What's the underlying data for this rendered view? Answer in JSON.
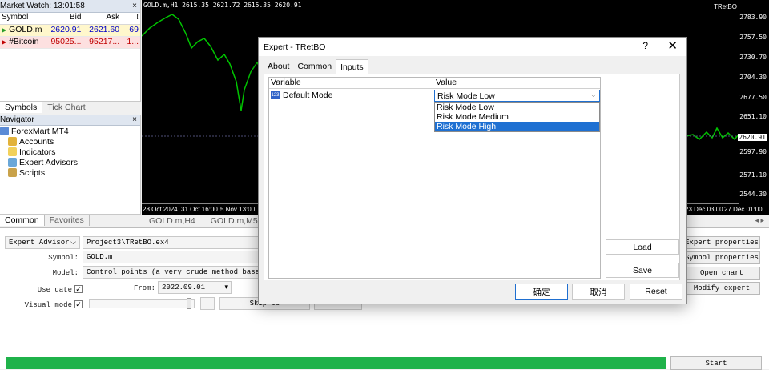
{
  "market_watch": {
    "title": "Market Watch: 13:01:58",
    "close": "×",
    "headers": {
      "symbol": "Symbol",
      "bid": "Bid",
      "ask": "Ask",
      "spread": "!"
    },
    "rows": [
      {
        "symbol": "GOLD.m",
        "bid": "2620.91",
        "ask": "2621.60",
        "spread": "69"
      },
      {
        "symbol": "#Bitcoin",
        "bid": "95025...",
        "ask": "95217...",
        "spread": "1..."
      }
    ],
    "tabs": [
      "Symbols",
      "Tick Chart"
    ]
  },
  "navigator": {
    "title": "Navigator",
    "close": "×",
    "root": "ForexMart MT4",
    "items": [
      "Accounts",
      "Indicators",
      "Expert Advisors",
      "Scripts"
    ],
    "tabs": [
      "Common",
      "Favorites"
    ]
  },
  "chart": {
    "header": "GOLD.m,H1  2615.35 2621.72 2615.35 2620.91",
    "name": "TRetBO",
    "prices": [
      "2783.90",
      "2757.50",
      "2730.70",
      "2704.30",
      "2677.50",
      "2651.10",
      "2620.91",
      "2597.90",
      "2571.10",
      "2544.30"
    ],
    "current_price": "2620.91",
    "times_left": [
      "28 Oct 2024",
      "31 Oct 16:00",
      "5 Nov 13:00"
    ],
    "times_right": [
      "23 Dec 03:00",
      "27 Dec 01:00"
    ],
    "tabs": [
      "GOLD.m,H4",
      "GOLD.m,M5"
    ],
    "colors": {
      "background": "#000000",
      "candles": "#00c400"
    }
  },
  "tester": {
    "type": "Expert Advisor",
    "ea_path": "Project3\\TRetBO.ex4",
    "symbol_label": "Symbol:",
    "symbol": "GOLD.m",
    "model_label": "Model:",
    "model": "Control points (a very crude method based on the",
    "use_date_label": "Use date",
    "from_label": "From:",
    "from_date": "2022.09.01",
    "visual_mode_label": "Visual mode",
    "skip_label": "Skip to",
    "buttons": {
      "expert_properties": "Expert properties",
      "symbol_properties": "Symbol properties",
      "open_chart": "Open chart",
      "modify_expert": "Modify expert",
      "start": "Start"
    },
    "progress": 1.0
  },
  "dialog": {
    "title": "Expert - TRetBO",
    "help": "?",
    "close": "✕",
    "tabs": [
      "About",
      "Common",
      "Inputs"
    ],
    "active_tab": "Inputs",
    "columns": {
      "variable": "Variable",
      "value": "Value"
    },
    "row": {
      "variable": "Default Mode",
      "value": "Risk Mode Low",
      "badge": "123"
    },
    "options": [
      "Risk Mode Low",
      "Risk Mode Medium",
      "Risk Mode High"
    ],
    "highlighted_option": "Risk Mode High",
    "side_buttons": {
      "load": "Load",
      "save": "Save"
    },
    "footer_buttons": {
      "ok": "确定",
      "cancel": "取消",
      "reset": "Reset"
    }
  }
}
